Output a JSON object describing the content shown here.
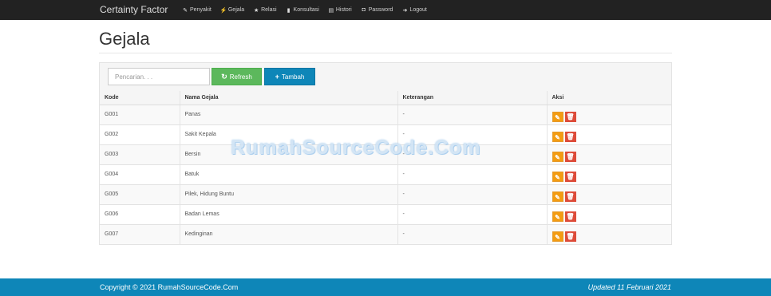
{
  "navbar": {
    "brand": "Certainty Factor",
    "items": [
      {
        "label": "Penyakit",
        "icon": "✎"
      },
      {
        "label": "Gejala",
        "icon": "⚡"
      },
      {
        "label": "Relasi",
        "icon": "★"
      },
      {
        "label": "Konsultasi",
        "icon": "▮"
      },
      {
        "label": "Histori",
        "icon": "▤"
      },
      {
        "label": "Password",
        "icon": "◘"
      },
      {
        "label": "Logout",
        "icon": "➜"
      }
    ]
  },
  "page": {
    "title": "Gejala"
  },
  "toolbar": {
    "search_placeholder": "Pencarian. . .",
    "search_value": "",
    "refresh_label": "Refresh",
    "refresh_icon": "↻",
    "add_label": "Tambah",
    "add_icon": "+"
  },
  "table": {
    "headers": [
      "Kode",
      "Nama Gejala",
      "Keterangan",
      "Aksi"
    ],
    "rows": [
      {
        "kode": "G001",
        "nama": "Panas",
        "keterangan": "-"
      },
      {
        "kode": "G002",
        "nama": "Sakit Kepala",
        "keterangan": "-"
      },
      {
        "kode": "G003",
        "nama": "Bersin",
        "keterangan": "-"
      },
      {
        "kode": "G004",
        "nama": "Batuk",
        "keterangan": "-"
      },
      {
        "kode": "G005",
        "nama": "Pilek, Hidung Buntu",
        "keterangan": "-"
      },
      {
        "kode": "G006",
        "nama": "Badan Lemas",
        "keterangan": "-"
      },
      {
        "kode": "G007",
        "nama": "Kedinginan",
        "keterangan": "-"
      }
    ],
    "edit_icon": "✎",
    "delete_icon": "🗑"
  },
  "watermark": "RumahSourceCode.Com",
  "footer": {
    "copyright": "Copyright © 2021 RumahSourceCode.Com",
    "updated": "Updated 11 Februari 2021"
  },
  "colors": {
    "navbar": "#222222",
    "footer": "#0e86b8",
    "refresh": "#5cb85c",
    "add": "#0e86b8",
    "edit": "#f39c12",
    "delete": "#dd4b39"
  }
}
